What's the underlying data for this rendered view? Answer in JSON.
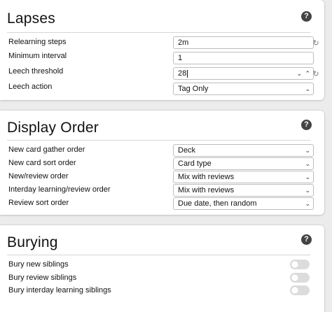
{
  "lapses": {
    "title": "Lapses",
    "help_icon": "?",
    "relearning_steps": {
      "label": "Relearning steps",
      "value": "2m"
    },
    "minimum_interval": {
      "label": "Minimum interval",
      "value": "1"
    },
    "leech_threshold": {
      "label": "Leech threshold",
      "value": "28"
    },
    "leech_action": {
      "label": "Leech action",
      "value": "Tag Only"
    }
  },
  "display_order": {
    "title": "Display Order",
    "help_icon": "?",
    "rows": [
      {
        "label": "New card gather order",
        "value": "Deck"
      },
      {
        "label": "New card sort order",
        "value": "Card type"
      },
      {
        "label": "New/review order",
        "value": "Mix with reviews"
      },
      {
        "label": "Interday learning/review order",
        "value": "Mix with reviews"
      },
      {
        "label": "Review sort order",
        "value": "Due date, then random"
      }
    ]
  },
  "burying": {
    "title": "Burying",
    "help_icon": "?",
    "rows": [
      {
        "label": "Bury new siblings",
        "enabled": false
      },
      {
        "label": "Bury review siblings",
        "enabled": false
      },
      {
        "label": "Bury interday learning siblings",
        "enabled": false
      }
    ]
  },
  "icons": {
    "chevron_down": "⌄",
    "chevron_up": "⌃",
    "reset": "↻"
  }
}
